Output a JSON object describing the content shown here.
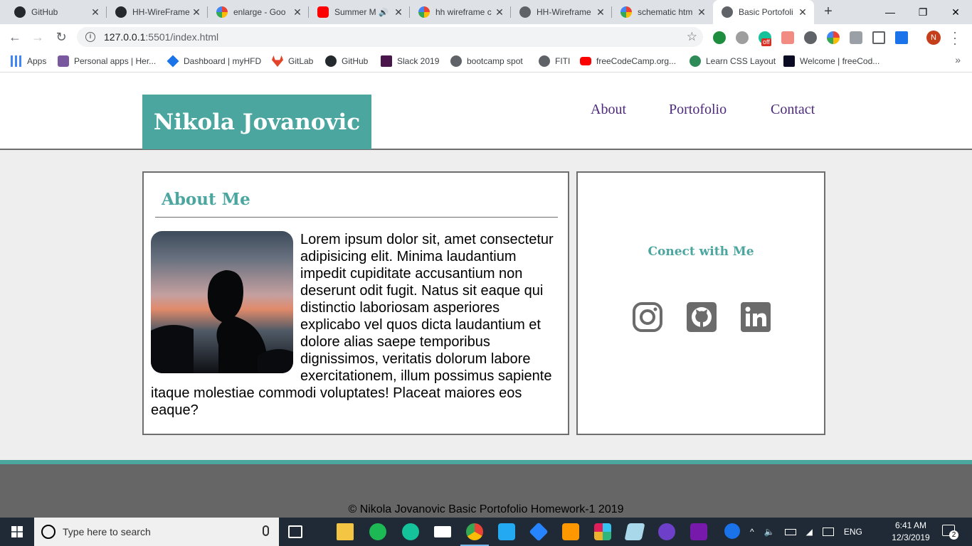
{
  "browser": {
    "tabs": [
      {
        "title": "GitHub",
        "icon": "github-icon",
        "color": "#24292e"
      },
      {
        "title": "HH-WireFrame",
        "icon": "github-icon",
        "color": "#24292e"
      },
      {
        "title": "enlarge - Goo",
        "icon": "google-icon",
        "color": "#4285f4"
      },
      {
        "title": "Summer M",
        "icon": "youtube-icon",
        "color": "#ff0000"
      },
      {
        "title": "hh wireframe c",
        "icon": "google-icon",
        "color": "#4285f4"
      },
      {
        "title": "HH-Wireframe",
        "icon": "globe-icon",
        "color": "#5f6368"
      },
      {
        "title": "schematic htm",
        "icon": "google-icon",
        "color": "#4285f4"
      },
      {
        "title": "Basic Portofoli",
        "icon": "globe-icon",
        "color": "#5f6368"
      }
    ],
    "new_tab": "+",
    "window_controls": {
      "minimize": "—",
      "maximize": "❐",
      "close": "✕"
    },
    "url_host": "127.0.0.1",
    "url_rest": ":5501/index.html",
    "profile_initial": "N",
    "extension_badge": "off",
    "bookmarks": [
      {
        "label": "Apps",
        "icon": "apps-grid-icon",
        "color": "#4285f4"
      },
      {
        "label": "Personal apps | Her...",
        "icon": "heroku-icon",
        "color": "#79589f"
      },
      {
        "label": "Dashboard | myHFD",
        "icon": "myhfd-icon",
        "color": "#1a73e8"
      },
      {
        "label": "GitLab",
        "icon": "gitlab-icon",
        "color": "#e24329"
      },
      {
        "label": "GitHub",
        "icon": "github-icon",
        "color": "#24292e"
      },
      {
        "label": "Slack 2019",
        "icon": "slack-icon",
        "color": "#4a154b"
      },
      {
        "label": "bootcamp spot",
        "icon": "globe-icon",
        "color": "#5f6368"
      },
      {
        "label": "FITI",
        "icon": "globe-icon",
        "color": "#5f6368"
      },
      {
        "label": "freeCodeCamp.org...",
        "icon": "youtube-icon",
        "color": "#ff0000"
      },
      {
        "label": "Learn CSS Layout",
        "icon": "css-layout-icon",
        "color": "#2e8b57"
      },
      {
        "label": "Welcome | freeCod...",
        "icon": "freecodecamp-icon",
        "color": "#0a0a23"
      }
    ],
    "bookmarks_more": "»"
  },
  "site": {
    "brand": "Nikola Jovanovic",
    "nav": [
      "About",
      "Portofolio",
      "Contact"
    ],
    "about": {
      "title": "About Me",
      "body": "Lorem ipsum dolor sit, amet consectetur adipisicing elit. Minima laudantium impedit cupiditate accusantium non deserunt odit fugit. Natus sit eaque qui distinctio laboriosam asperiores explicabo vel quos dicta laudantium et dolore alias saepe temporibus dignissimos, veritatis dolorum labore exercitationem, illum possimus sapiente itaque molestiae commodi voluptates! Placeat maiores eos eaque?"
    },
    "connect": {
      "title": "Conect with Me",
      "links": [
        "instagram-icon",
        "github-icon",
        "linkedin-icon"
      ]
    },
    "footer": "© Nikola Jovanovic Basic Portofolio Homework-1 2019",
    "colors": {
      "accent": "#4aa69f",
      "nav": "#4b2a7a",
      "border": "#6e6e6e",
      "footer": "#666666",
      "background": "#eeeeee"
    }
  },
  "taskbar": {
    "search_placeholder": "Type here to search",
    "apps": [
      "task-view-icon",
      "file-explorer-icon",
      "spotify-icon",
      "grammarly-icon",
      "mail-icon",
      "chrome-icon",
      "vscode-icon",
      "sourcetree-icon",
      "sublime-icon",
      "slack-icon",
      "notes-icon",
      "github-desktop-icon",
      "onenote-icon"
    ],
    "language": "ENG",
    "time": "6:41 AM",
    "date": "12/3/2019",
    "notification_count": "2"
  }
}
